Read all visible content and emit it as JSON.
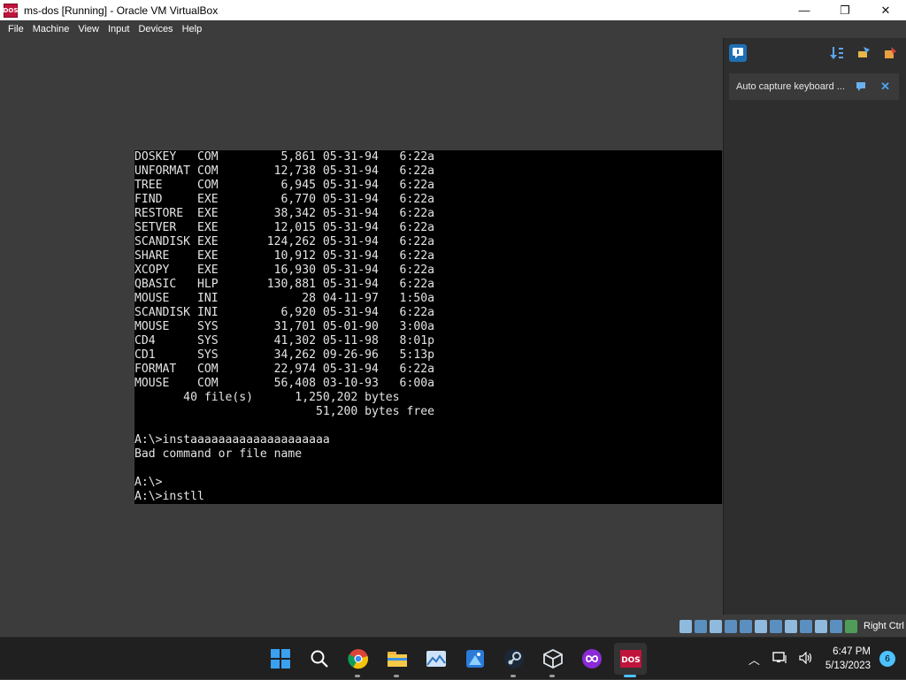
{
  "window": {
    "title": "ms-dos [Running] - Oracle VM VirtualBox",
    "app_icon_text": "DOS",
    "minimize_glyph": "—",
    "maximize_glyph": "❐",
    "close_glyph": "✕"
  },
  "menu": [
    "File",
    "Machine",
    "View",
    "Input",
    "Devices",
    "Help"
  ],
  "dos_screen_lines": [
    "DOSKEY   COM         5,861 05-31-94   6:22a",
    "UNFORMAT COM        12,738 05-31-94   6:22a",
    "TREE     COM         6,945 05-31-94   6:22a",
    "FIND     EXE         6,770 05-31-94   6:22a",
    "RESTORE  EXE        38,342 05-31-94   6:22a",
    "SETVER   EXE        12,015 05-31-94   6:22a",
    "SCANDISK EXE       124,262 05-31-94   6:22a",
    "SHARE    EXE        10,912 05-31-94   6:22a",
    "XCOPY    EXE        16,930 05-31-94   6:22a",
    "QBASIC   HLP       130,881 05-31-94   6:22a",
    "MOUSE    INI            28 04-11-97   1:50a",
    "SCANDISK INI         6,920 05-31-94   6:22a",
    "MOUSE    SYS        31,701 05-01-90   3:00a",
    "CD4      SYS        41,302 05-11-98   8:01p",
    "CD1      SYS        34,262 09-26-96   5:13p",
    "FORMAT   COM        22,974 05-31-94   6:22a",
    "MOUSE    COM        56,408 03-10-93   6:00a",
    "       40 file(s)      1,250,202 bytes",
    "                          51,200 bytes free",
    "",
    "A:\\>instaaaaaaaaaaaaaaaaaaaa",
    "Bad command or file name",
    "",
    "A:\\>",
    "A:\\>instll"
  ],
  "notification": {
    "text": "Auto capture keyboard ...",
    "icons": [
      "info-icon",
      "sort-icon",
      "pin-icon",
      "delete-all-icon"
    ]
  },
  "statusbar": {
    "host_key_label": "Right Ctrl"
  },
  "taskbar": {
    "apps": [
      "start",
      "search",
      "chrome",
      "file-explorer",
      "photos",
      "paint",
      "steam",
      "virtualbox",
      "app-infinity",
      "ms-dos"
    ],
    "clock_time": "6:47 PM",
    "clock_date": "5/13/2023",
    "notification_count": "6"
  },
  "colors": {
    "accent": "#4cc2ff",
    "dos_text": "#e4e4e4",
    "dos_bg": "#000000"
  }
}
